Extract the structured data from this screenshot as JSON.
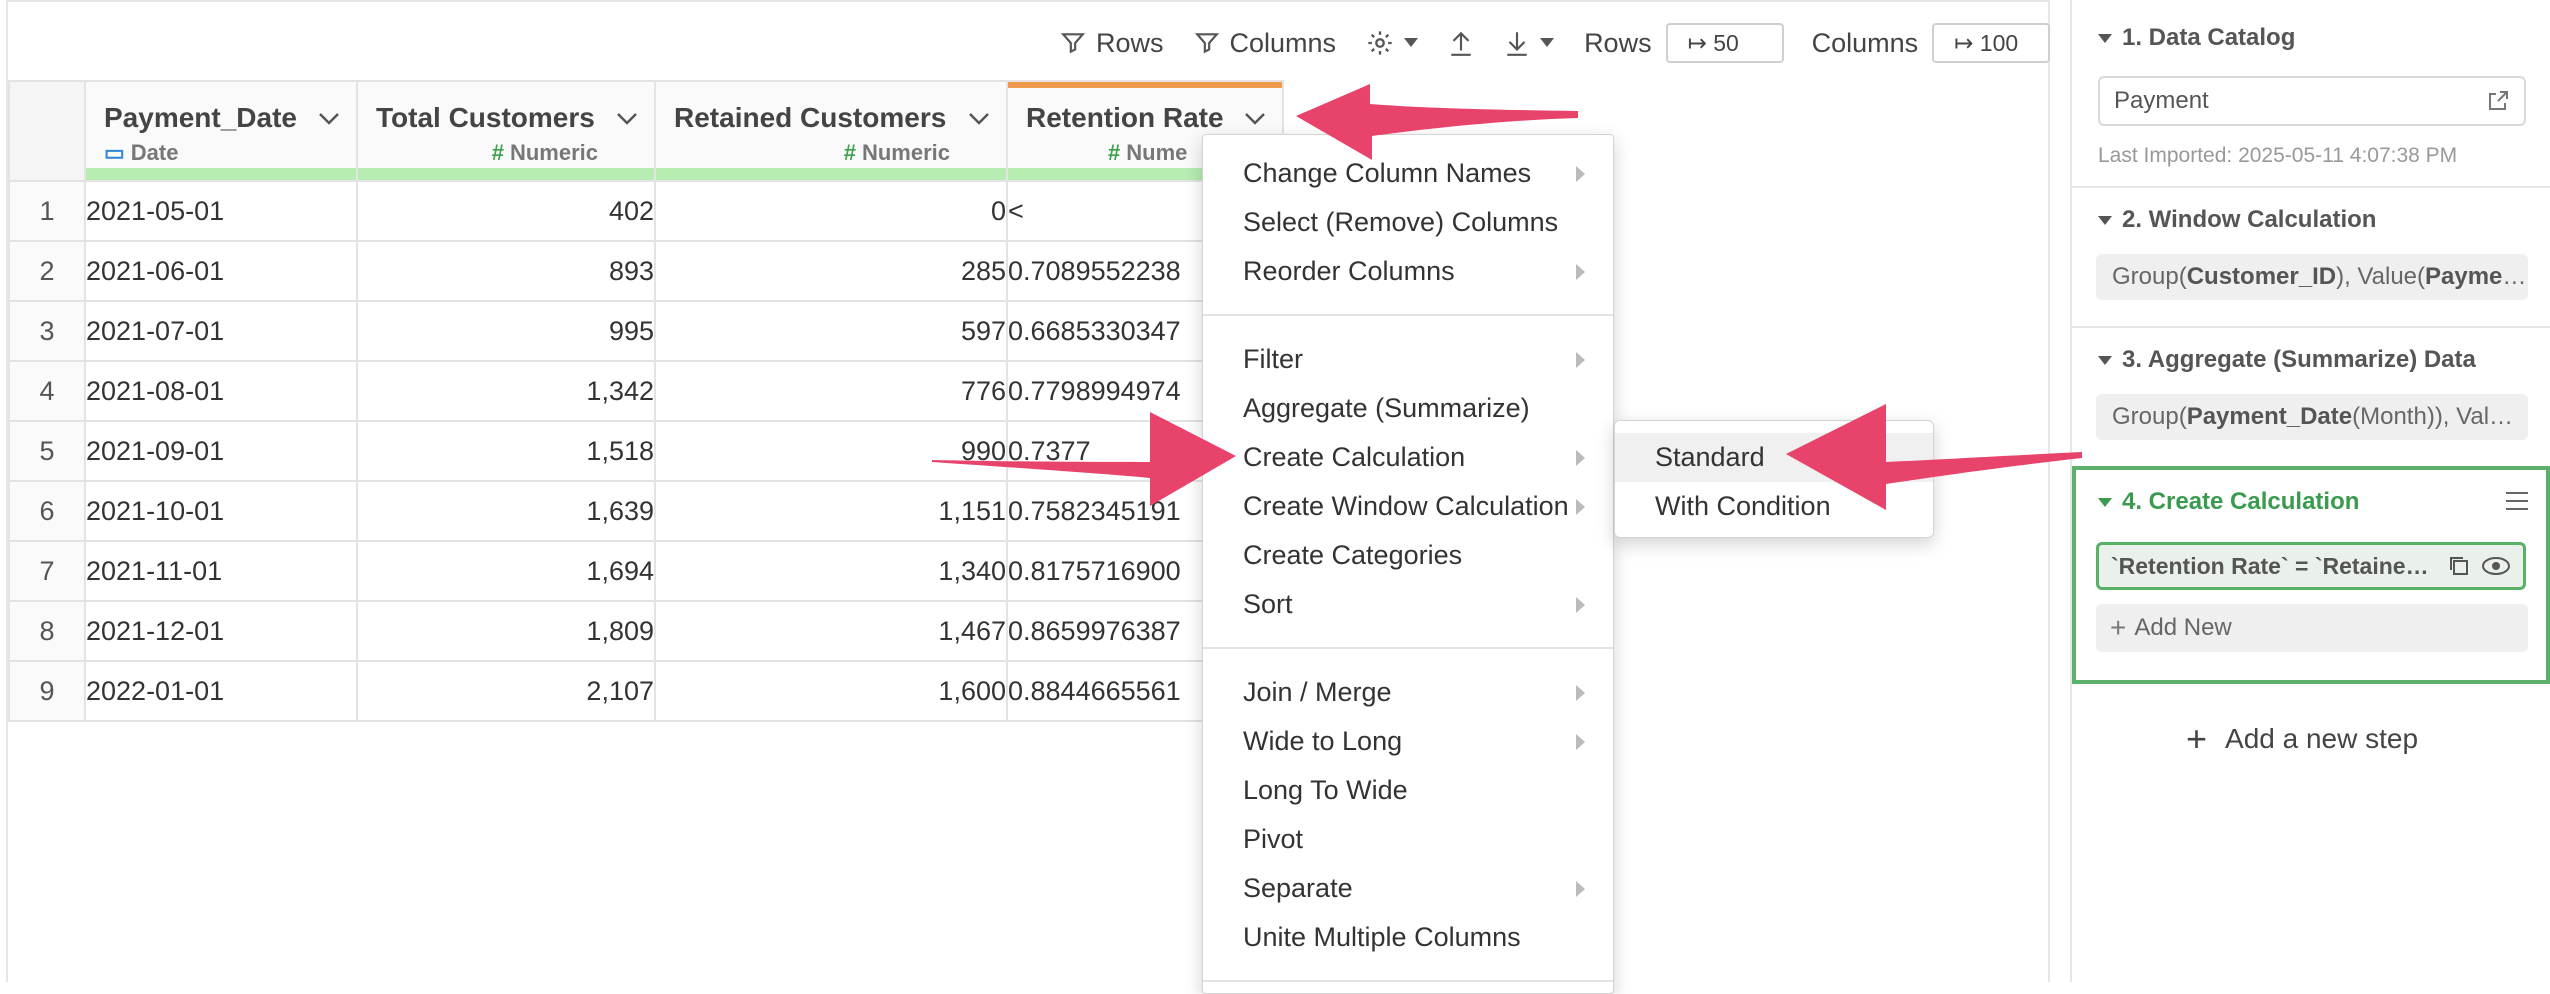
{
  "toolbar": {
    "rows_label": "Rows",
    "columns_label": "Columns",
    "rows_count_label": "Rows",
    "rows_count_value": "↦ 50",
    "columns_count_label": "Columns",
    "columns_count_value": "↦ 100",
    "icons": [
      "filter-icon",
      "gear-icon",
      "upload-icon",
      "download-icon"
    ]
  },
  "table": {
    "columns": [
      {
        "name": "Payment_Date",
        "type": "Date"
      },
      {
        "name": "Total Customers",
        "type": "Numeric"
      },
      {
        "name": "Retained Customers",
        "type": "Numeric"
      },
      {
        "name": "Retention Rate",
        "type": "Nume"
      }
    ],
    "rows": [
      {
        "n": "1",
        "date": "2021-05-01",
        "total": "402",
        "retained": "0",
        "rate": "<"
      },
      {
        "n": "2",
        "date": "2021-06-01",
        "total": "893",
        "retained": "285",
        "rate": "0.7089552238"
      },
      {
        "n": "3",
        "date": "2021-07-01",
        "total": "995",
        "retained": "597",
        "rate": "0.6685330347"
      },
      {
        "n": "4",
        "date": "2021-08-01",
        "total": "1,342",
        "retained": "776",
        "rate": "0.7798994974"
      },
      {
        "n": "5",
        "date": "2021-09-01",
        "total": "1,518",
        "retained": "990",
        "rate": "0.7377"
      },
      {
        "n": "6",
        "date": "2021-10-01",
        "total": "1,639",
        "retained": "1,151",
        "rate": "0.7582345191"
      },
      {
        "n": "7",
        "date": "2021-11-01",
        "total": "1,694",
        "retained": "1,340",
        "rate": "0.8175716900"
      },
      {
        "n": "8",
        "date": "2021-12-01",
        "total": "1,809",
        "retained": "1,467",
        "rate": "0.8659976387"
      },
      {
        "n": "9",
        "date": "2022-01-01",
        "total": "2,107",
        "retained": "1,600",
        "rate": "0.8844665561"
      }
    ]
  },
  "menu": {
    "group1": [
      {
        "label": "Change Column Names",
        "submenu": true
      },
      {
        "label": "Select (Remove) Columns",
        "submenu": false
      },
      {
        "label": "Reorder Columns",
        "submenu": true
      }
    ],
    "group2": [
      {
        "label": "Filter",
        "submenu": true
      },
      {
        "label": "Aggregate (Summarize)",
        "submenu": false
      },
      {
        "label": "Create Calculation",
        "submenu": true
      },
      {
        "label": "Create Window Calculation",
        "submenu": true
      },
      {
        "label": "Create Categories",
        "submenu": false
      },
      {
        "label": "Sort",
        "submenu": true
      }
    ],
    "group3": [
      {
        "label": "Join / Merge",
        "submenu": true
      },
      {
        "label": "Wide to Long",
        "submenu": true
      },
      {
        "label": "Long To Wide",
        "submenu": false
      },
      {
        "label": "Pivot",
        "submenu": false
      },
      {
        "label": "Separate",
        "submenu": true
      },
      {
        "label": "Unite Multiple Columns",
        "submenu": false
      }
    ]
  },
  "submenu": {
    "items": [
      "Standard",
      "With Condition"
    ]
  },
  "panel": {
    "step1": {
      "title": "1. Data Catalog",
      "source": "Payment",
      "imported": "Last Imported: 2025-05-11 4:07:38 PM"
    },
    "step2": {
      "title": "2. Window Calculation",
      "pre1": "Group(",
      "bold1": "Customer_ID",
      "mid1": "), Value(",
      "bold2": "Payme",
      "tail": "…"
    },
    "step3": {
      "title": "3. Aggregate (Summarize) Data",
      "pre1": "Group(",
      "bold1": "Payment_Date",
      "mid1": " (Month)), Val",
      "tail": "…"
    },
    "step4": {
      "title": "4. Create Calculation",
      "expr": "`Retention Rate` = `Retaine…",
      "add_new": "Add New"
    },
    "add_step": "Add a new step"
  },
  "colors": {
    "accent_green": "#3a9a4e",
    "type_bar": "#b7ecb3",
    "active_column": "#ef9a4d",
    "arrow": "#e8436a"
  }
}
